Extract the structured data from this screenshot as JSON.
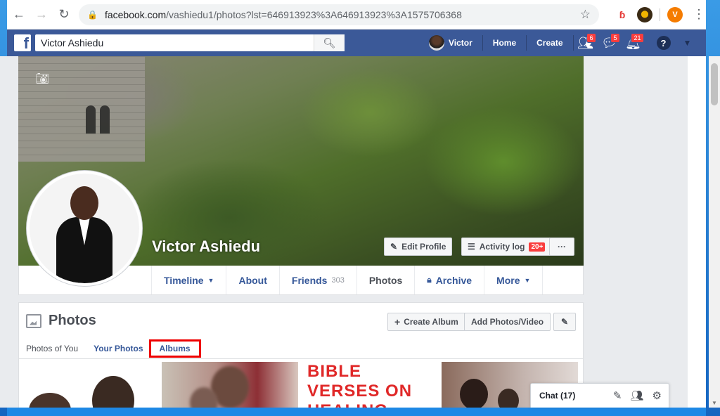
{
  "browser": {
    "url_host": "facebook.com",
    "url_path": "/vashiedu1/photos?lst=646913923%3A646913923%3A1575706368",
    "profile_initial": "V"
  },
  "fb_header": {
    "search_value": "Victor Ashiedu",
    "user_name": "Victor",
    "home": "Home",
    "create": "Create",
    "friend_requests_count": "6",
    "messages_count": "5",
    "notifications_count": "21",
    "help": "?"
  },
  "profile": {
    "name": "Victor Ashiedu",
    "edit_profile": "Edit Profile",
    "activity_log": "Activity log",
    "activity_badge": "20+",
    "more_dots": "···"
  },
  "nav": {
    "tabs": [
      {
        "label": "Timeline",
        "count": "",
        "caret": true
      },
      {
        "label": "About",
        "count": "",
        "caret": false
      },
      {
        "label": "Friends",
        "count": "303",
        "caret": false
      },
      {
        "label": "Photos",
        "count": "",
        "caret": false
      },
      {
        "label": "Archive",
        "count": "",
        "caret": false
      },
      {
        "label": "More",
        "count": "",
        "caret": true
      }
    ]
  },
  "photos": {
    "title": "Photos",
    "create_album": "Create Album",
    "add_photos": "Add Photos/Video",
    "sub_tabs": [
      "Photos of You",
      "Your Photos",
      "Albums"
    ],
    "thumb3_text": "BIBLE VERSES ON HEALING"
  },
  "chat": {
    "label": "Chat (17)"
  },
  "colors": {
    "fb_blue": "#3b5998",
    "link_blue": "#365899",
    "badge_red": "#fa3e3e",
    "highlight_red": "#e00000"
  }
}
